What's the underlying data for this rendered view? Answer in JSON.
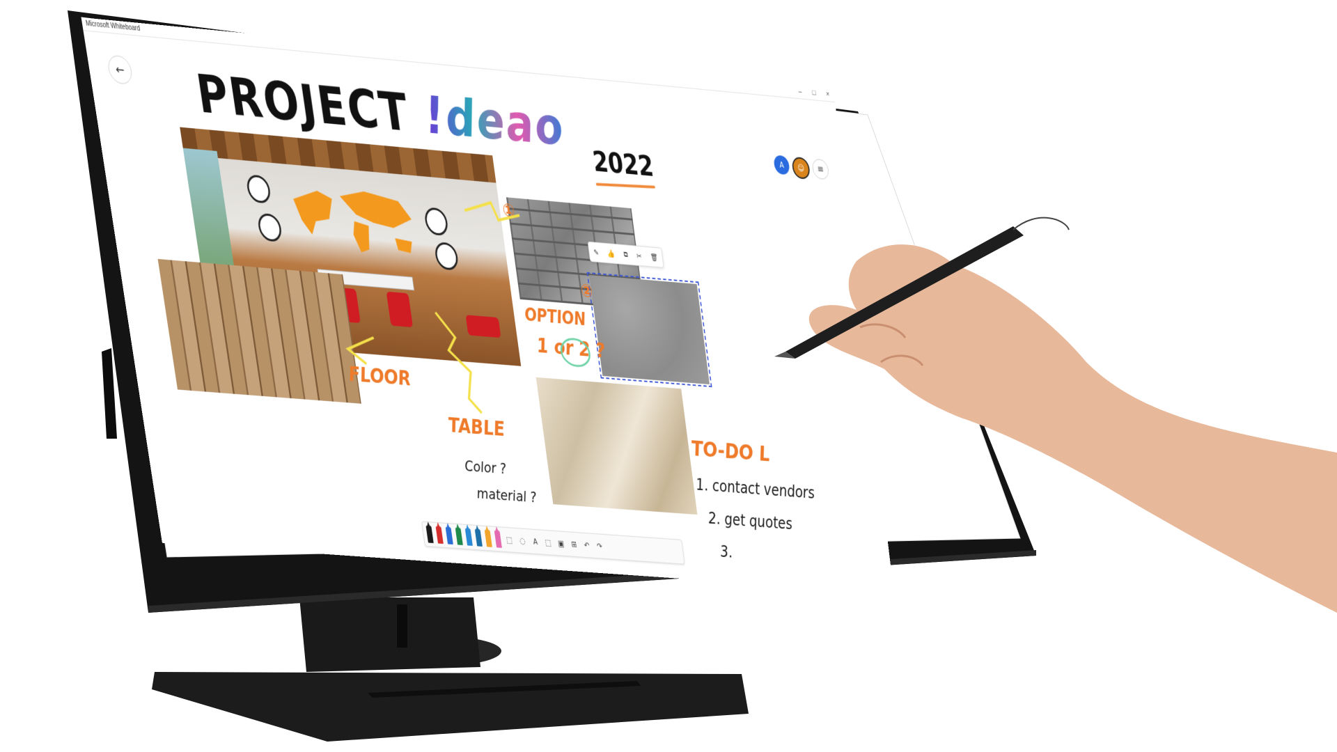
{
  "window": {
    "app_title": "Microsoft Whiteboard",
    "minimize": "–",
    "maximize": "□",
    "close": "×"
  },
  "board": {
    "back_icon": "←",
    "title_main": "PROJECT",
    "title_accent": "!deao",
    "year": "2022"
  },
  "users": {
    "avatar_a": "A",
    "avatar_b": "☺",
    "menu_icon": "≡"
  },
  "context_toolbar": {
    "items": [
      "✎",
      "👍",
      "⧉",
      "✂",
      "🗑"
    ]
  },
  "annotations": {
    "marker_1": "①",
    "marker_2": "②",
    "floor": "FLOOR",
    "table": "TABLE",
    "option": "OPTION",
    "option_choice": "1 or 2 ?",
    "color_q": "Color ?",
    "material_q": "material ?"
  },
  "todo": {
    "title": "TO-DO L",
    "item_1": "1. contact vendors",
    "item_2": "2. get quotes",
    "item_3": "3."
  },
  "pen_toolbar": {
    "pens": [
      "#1a1a1a",
      "#d62d2d",
      "#2b6fd6",
      "#1f8a4c",
      "#2b8ad6",
      "#1d6fa8",
      "#f2a62b",
      "#e46bb0"
    ],
    "tools": [
      "⬚",
      "◌",
      "A",
      "⬚",
      "▣",
      "⊞",
      "↶",
      "↷"
    ]
  },
  "colors": {
    "bezel": "#141414",
    "accent_orange": "#ee7a2a",
    "selection_blue": "#3e57d6"
  }
}
